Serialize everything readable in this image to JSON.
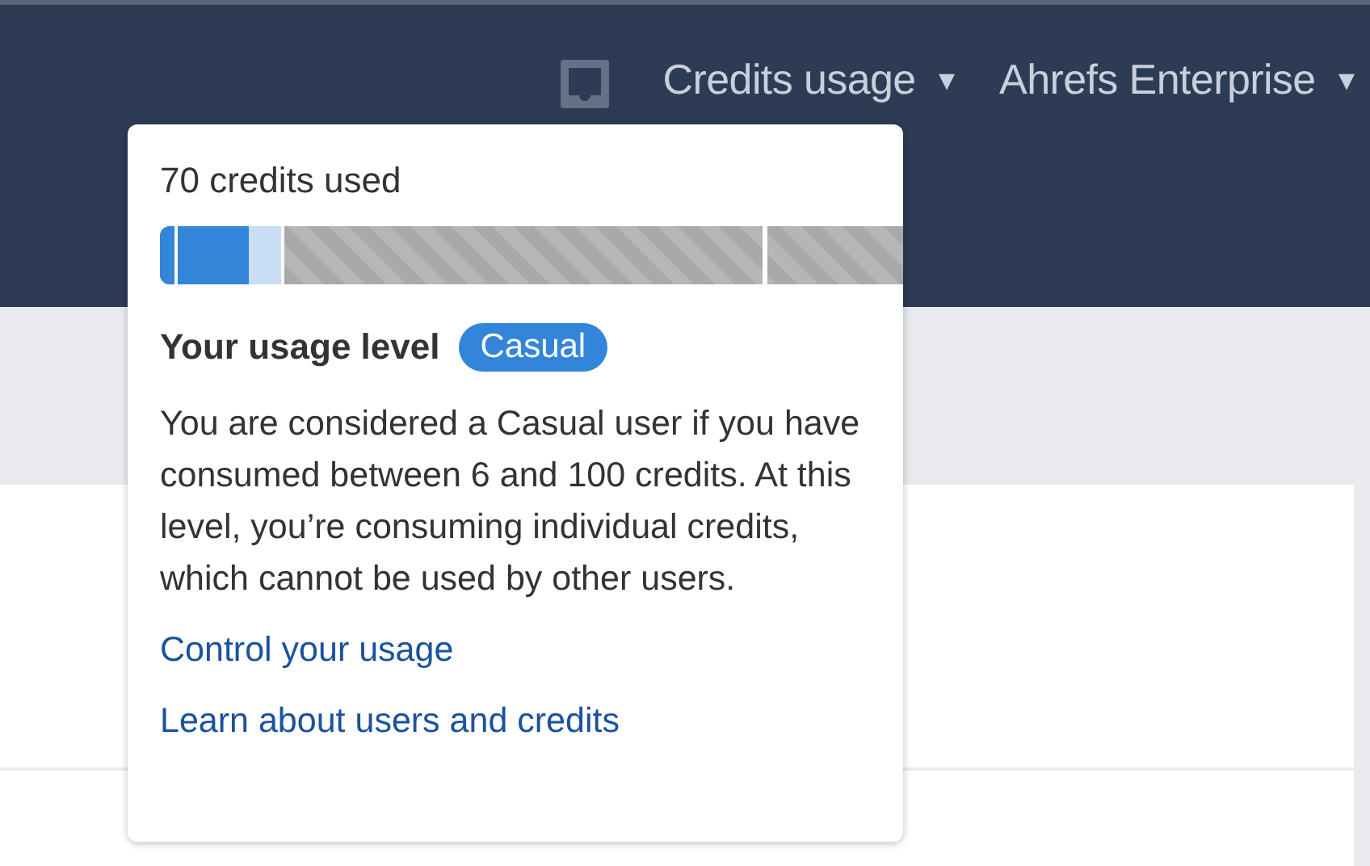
{
  "navbar": {
    "items": [
      {
        "kind": "icon"
      },
      {
        "kind": "menu",
        "label": "Credits usage",
        "caret": "▾"
      },
      {
        "kind": "menu",
        "label": "Ahrefs Enterprise",
        "caret": "▾"
      }
    ]
  },
  "popup": {
    "title": "70 credits used",
    "usage": {
      "level": 0.12
    },
    "level_label": "Your usage level",
    "badge": "Casual",
    "description": "You are considered a Casual user if you have consumed between 6 and 100 credits. At this level, you’re consuming individual credits, which cannot be used by other users.",
    "links": [
      "Control your usage",
      "Learn about users and credits"
    ]
  }
}
